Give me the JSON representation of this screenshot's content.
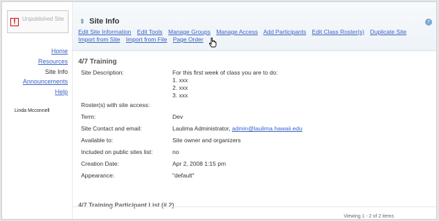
{
  "sidebar": {
    "unpublished_badge": "!",
    "unpublished_text": "Unpublished Site",
    "nav": [
      {
        "label": "Home",
        "link": true
      },
      {
        "label": "Resources",
        "link": true
      },
      {
        "label": "Site Info",
        "link": false
      },
      {
        "label": "Announcements",
        "link": true
      },
      {
        "label": "Help",
        "link": true
      }
    ],
    "user": "Linda Mcconnell"
  },
  "header": {
    "title": "Site Info",
    "help_icon": "?",
    "toolbar_row1": [
      "Edit Site Information",
      "Edit Tools",
      "Manage Groups",
      "Manage Access",
      "Add Participants",
      "Edit Class Roster(s)",
      "Duplicate Site"
    ],
    "toolbar_row2": [
      "Import from Site",
      "Import from File",
      "Page Order"
    ]
  },
  "site": {
    "name": "4/7 Training",
    "description_label": "Site Description:",
    "description": [
      "For this first week of class you are to do:",
      "1. xxx",
      "2. xxx",
      "3. xxx"
    ],
    "roster_label": "Roster(s) with site access:",
    "term_label": "Term:",
    "term": "Dev",
    "contact_label": "Site Contact and email:",
    "contact_name": "Laulima Administrator,",
    "contact_email": "admin@laulima.hawaii.edu",
    "available_label": "Available to:",
    "available": "Site owner and organizers",
    "public_label": "Included on public sites list:",
    "public": "no",
    "created_label": "Creation Date:",
    "created": "Apr 2, 2008 1:15 pm",
    "appearance_label": "Appearance:",
    "appearance": "\"default\""
  },
  "participants": {
    "title": "4/7 Training Participant List (# 2)",
    "viewing": "Viewing 1 - 2 of 2 items"
  }
}
